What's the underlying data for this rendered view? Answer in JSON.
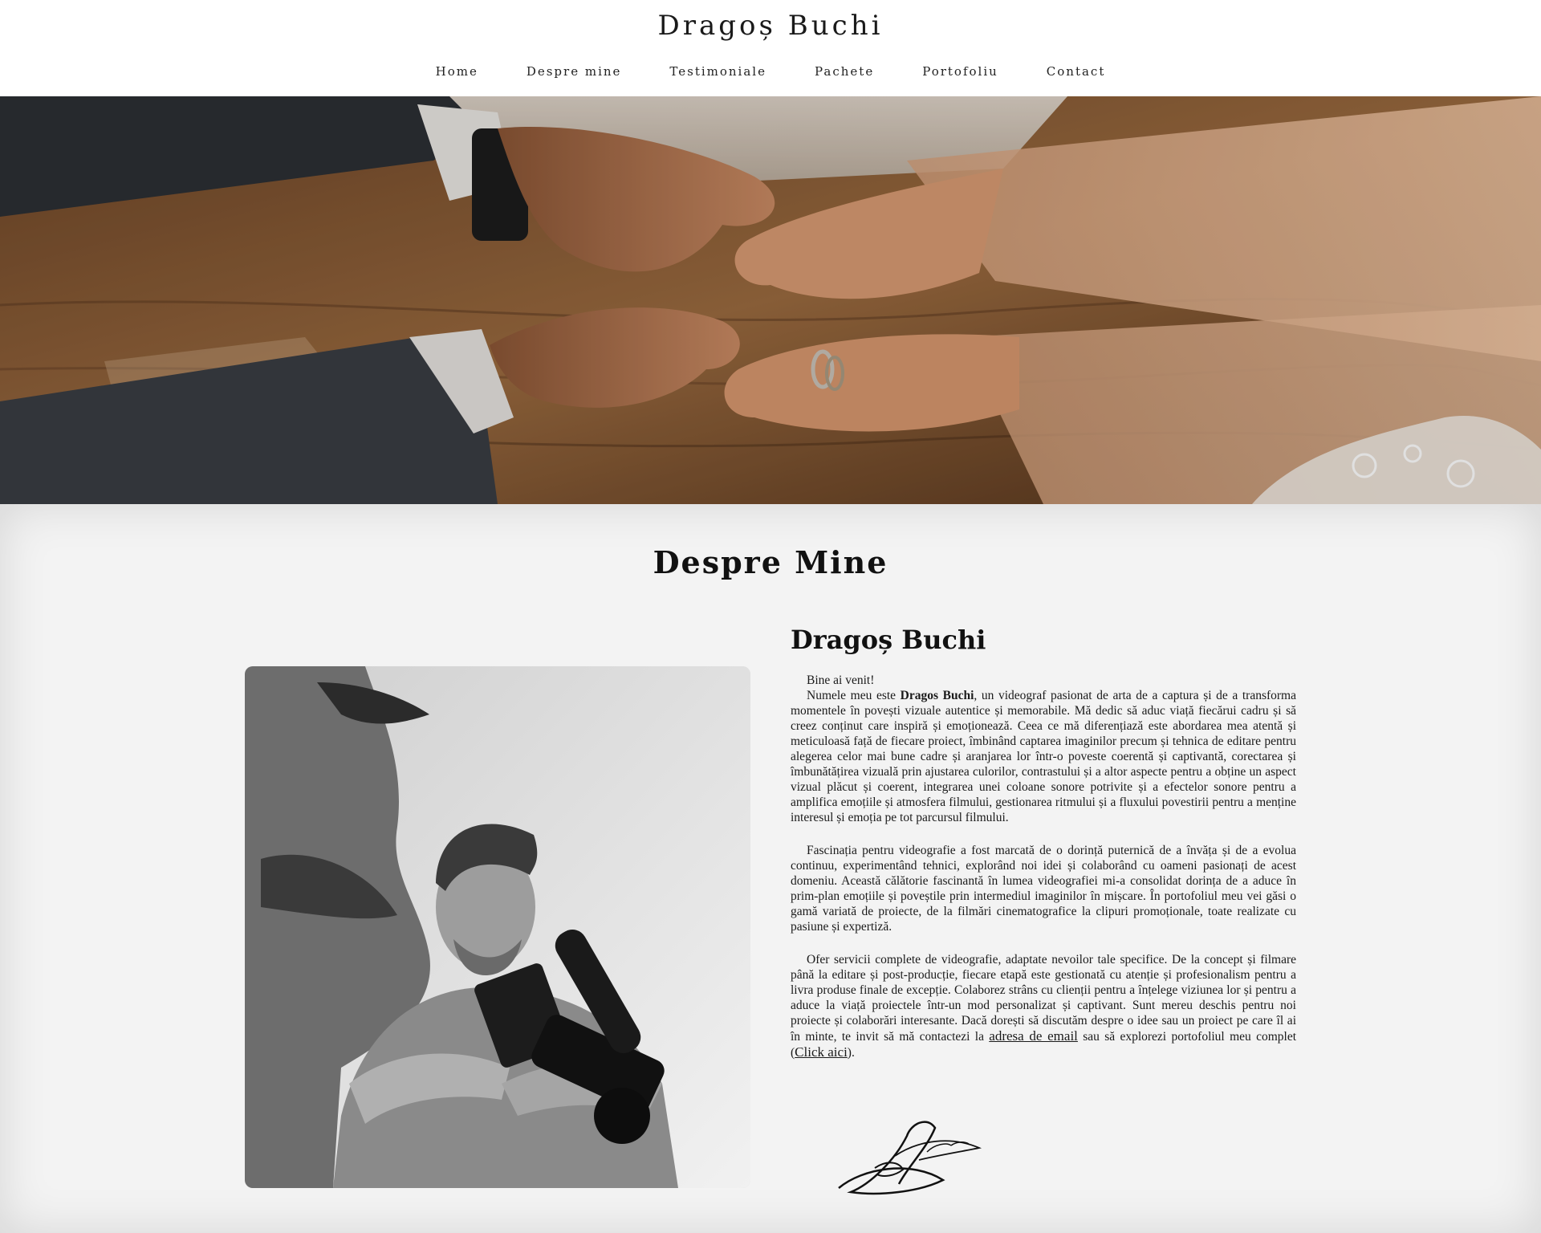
{
  "header": {
    "site_title": "Dragoș Buchi",
    "nav": [
      {
        "label": "Home"
      },
      {
        "label": "Despre mine"
      },
      {
        "label": "Testimoniale"
      },
      {
        "label": "Pachete"
      },
      {
        "label": "Portofoliu"
      },
      {
        "label": "Contact"
      }
    ]
  },
  "about": {
    "heading": "Despre Mine",
    "name": "Dragoș Buchi",
    "greeting": "Bine ai venit!",
    "p1_intro": "Numele meu este ",
    "p1_bold": "Dragos Buchi",
    "p1_rest": ", un videograf pasionat de arta de a captura și de a transforma momentele în povești vizuale autentice și memorabile. Mă dedic să aduc viață fiecărui cadru și să creez conținut care inspiră și emoționează. Ceea ce mă diferențiază este abordarea mea atentă și meticuloasă față de fiecare proiect, îmbinând captarea imaginilor precum și tehnica de editare pentru alegerea celor mai bune cadre și aranjarea lor într-o poveste coerentă și captivantă, corectarea și îmbunătățirea vizuală prin ajustarea culorilor, contrastului și a altor aspecte pentru a obține un aspect vizual plăcut și coerent, integrarea unei coloane sonore potrivite și a efectelor sonore pentru a amplifica emoțiile și atmosfera filmului, gestionarea ritmului și a fluxului povestirii pentru a menține interesul și emoția pe tot parcursul filmului.",
    "p2": "Fascinația pentru videografie a fost marcată de o dorință puternică de a învăța și de a evolua continuu, experimentând tehnici, explorând noi idei și colaborând cu oameni pasionați de acest domeniu. Această călătorie fascinantă în lumea videografiei mi-a consolidat dorința de a aduce în prim-plan emoțiile și poveștile prin intermediul imaginilor în mișcare. În portofoliul meu vei găsi o gamă variată de proiecte, de la filmări cinematografice la clipuri promoționale, toate realizate cu pasiune și expertiză.",
    "p3_start": "Ofer servicii complete de videografie, adaptate nevoilor tale specifice. De la concept și filmare până la editare și post-producție, fiecare etapă este gestionată cu atenție și profesionalism pentru a livra produse finale de excepție. Colaborez strâns cu clienții pentru a înțelege viziunea lor și pentru a aduce la viață proiectele într-un mod personalizat și captivant. Sunt mereu deschis pentru noi proiecte și colaborări interesante. Dacă dorești să discutăm despre o idee sau un proiect pe care îl ai în minte, te invit să mă contactezi la ",
    "email_link": "adresa de email",
    "p3_mid": " sau să explorezi portofoliul meu complet (",
    "click_link": "Click aici",
    "p3_end": ")."
  }
}
